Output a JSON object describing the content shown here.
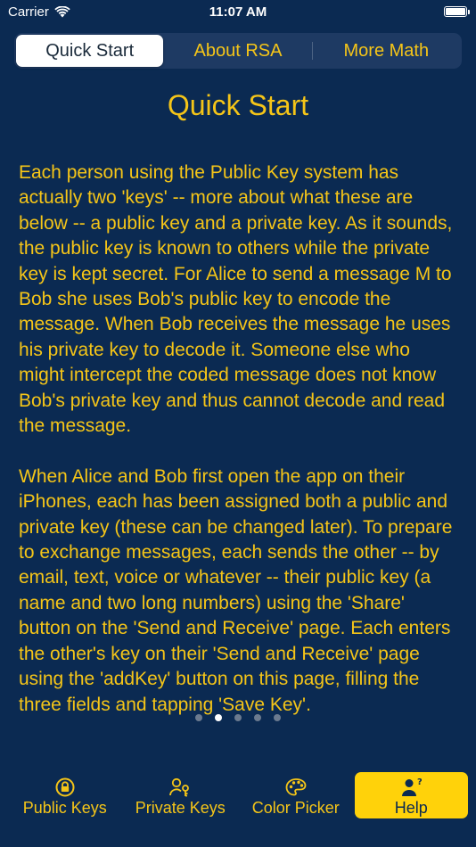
{
  "status_bar": {
    "carrier": "Carrier",
    "time": "11:07 AM"
  },
  "segments": [
    {
      "label": "Quick Start",
      "selected": true
    },
    {
      "label": "About RSA",
      "selected": false
    },
    {
      "label": "More Math",
      "selected": false
    }
  ],
  "page": {
    "title": "Quick Start",
    "paragraphs": [
      "Each person using the Public Key system has actually two 'keys' -- more about what these are below -- a public key and a private key. As it sounds, the public key is known to others while the private key is kept secret. For Alice to send a message M to Bob she uses Bob's public key to encode the message. When Bob receives the message he uses his private key to decode it. Someone else who might intercept the coded message does not know Bob's private key and thus cannot decode and read the message.",
      "When Alice and Bob first open the app on their iPhones, each has been assigned both a public and private key (these can be changed later). To prepare to exchange messages, each sends the other -- by email, text, voice or whatever -- their public key (a name and two long numbers) using the 'Share' button on the 'Send and Receive' page. Each enters the other's key on their 'Send and Receive' page using the 'addKey' button on this page, filling the three fields and tapping 'Save Key'."
    ]
  },
  "pager": {
    "count": 5,
    "active_index": 1
  },
  "tabs": [
    {
      "label": "Public Keys",
      "icon": "lock-icon"
    },
    {
      "label": "Private Keys",
      "icon": "person-key-icon"
    },
    {
      "label": "Color Picker",
      "icon": "palette-icon"
    },
    {
      "label": "Help",
      "icon": "person-question-icon"
    }
  ],
  "colors": {
    "background": "#0b2a52",
    "accent": "#f5c518",
    "selected_tab": "#ffd20a"
  }
}
